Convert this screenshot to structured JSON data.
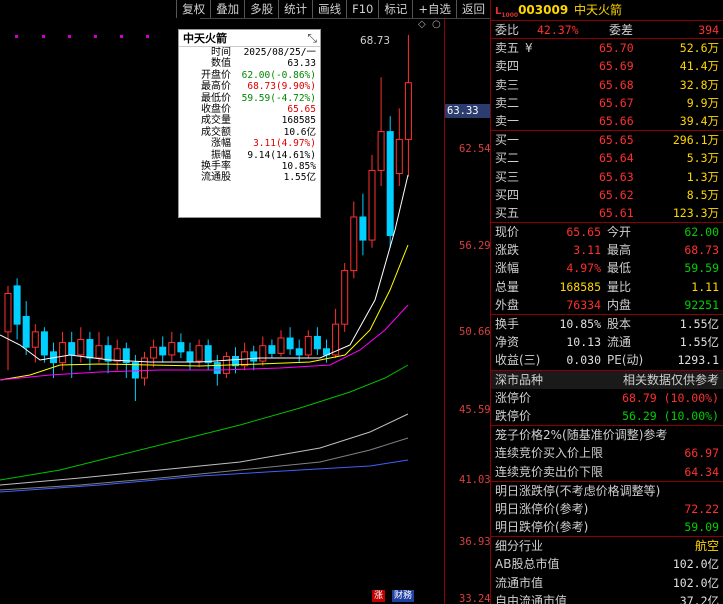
{
  "toolbar": {
    "buttons": [
      "复权",
      "叠加",
      "多股",
      "统计",
      "画线",
      "F10",
      "标记",
      "+自选",
      "返回"
    ]
  },
  "chart": {
    "axis_labels": [
      "62.54",
      "56.29",
      "50.66",
      "45.59",
      "41.03",
      "36.93",
      "33.24"
    ],
    "current_price": "63.33",
    "high_marker": "68.73",
    "bottom_tags": [
      "涨",
      "财務"
    ],
    "colors": {
      "up": "#ff3030",
      "down": "#00d0ff",
      "ma5": "#ffffff",
      "ma10": "#ffff00",
      "ma20": "#ff00ff",
      "ma60": "#00c000",
      "ma120": "#c0c0c0",
      "ma250": "#4060ff"
    }
  },
  "popup": {
    "title": "中天火箭",
    "rows": [
      {
        "label": "时间",
        "value": "2025/08/25/一",
        "color": ""
      },
      {
        "label": "数值",
        "value": "63.33",
        "color": ""
      },
      {
        "label": "开盘价",
        "value": "62.00(-0.86%)",
        "color": "green"
      },
      {
        "label": "最高价",
        "value": "68.73(9.90%)",
        "color": "red"
      },
      {
        "label": "最低价",
        "value": "59.59(-4.72%)",
        "color": "green"
      },
      {
        "label": "收盘价",
        "value": "65.65",
        "color": "red"
      },
      {
        "label": "成交量",
        "value": "168585",
        "color": ""
      },
      {
        "label": "成交额",
        "value": "10.6亿",
        "color": ""
      },
      {
        "label": "涨幅",
        "value": "3.11(4.97%)",
        "color": "red"
      },
      {
        "label": "振幅",
        "value": "9.14(14.61%)",
        "color": ""
      },
      {
        "label": "换手率",
        "value": "10.85%",
        "color": ""
      },
      {
        "label": "流通股",
        "value": "1.55亿",
        "color": ""
      }
    ]
  },
  "panel": {
    "logo": "L",
    "logo_sub": "1000",
    "code": "003009",
    "name": "中天火箭",
    "webi": {
      "label": "委比",
      "value": "42.37%",
      "label2": "委差",
      "value2": "394"
    },
    "asks": [
      {
        "label": "卖五",
        "price": "65.70",
        "vol": "52.6万"
      },
      {
        "label": "卖四",
        "price": "65.69",
        "vol": "41.4万"
      },
      {
        "label": "卖三",
        "price": "65.68",
        "vol": "32.8万"
      },
      {
        "label": "卖二",
        "price": "65.67",
        "vol": "9.9万"
      },
      {
        "label": "卖一",
        "price": "65.66",
        "vol": "39.4万"
      }
    ],
    "bids": [
      {
        "label": "买一",
        "price": "65.65",
        "vol": "296.1万"
      },
      {
        "label": "买二",
        "price": "65.64",
        "vol": "5.3万"
      },
      {
        "label": "买三",
        "price": "65.63",
        "vol": "1.3万"
      },
      {
        "label": "买四",
        "price": "65.62",
        "vol": "8.5万"
      },
      {
        "label": "买五",
        "price": "65.61",
        "vol": "123.3万"
      }
    ],
    "ask5_marker": "¥",
    "quote": [
      {
        "l1": "现价",
        "v1": "65.65",
        "c1": "red",
        "l2": "今开",
        "v2": "62.00",
        "c2": "green"
      },
      {
        "l1": "涨跌",
        "v1": "3.11",
        "c1": "red",
        "l2": "最高",
        "v2": "68.73",
        "c2": "red"
      },
      {
        "l1": "涨幅",
        "v1": "4.97%",
        "c1": "red",
        "l2": "最低",
        "v2": "59.59",
        "c2": "green"
      },
      {
        "l1": "总量",
        "v1": "168585",
        "c1": "yellow",
        "l2": "量比",
        "v2": "1.11",
        "c2": "yellow"
      },
      {
        "l1": "外盘",
        "v1": "76334",
        "c1": "red",
        "l2": "内盘",
        "v2": "92251",
        "c2": "green"
      }
    ],
    "stats": [
      {
        "l1": "换手",
        "v1": "10.85%",
        "l2": "股本",
        "v2": "1.55亿"
      },
      {
        "l1": "净资",
        "v1": "10.13",
        "l2": "流通",
        "v2": "1.55亿"
      },
      {
        "l1": "收益(三)",
        "v1": "0.030",
        "l2": "PE(动)",
        "v2": "1293.1"
      }
    ],
    "market": {
      "left": "深市品种",
      "right": "相关数据仅供参考"
    },
    "limits": [
      {
        "label": "涨停价",
        "value": "68.79 (10.00%)",
        "color": "red"
      },
      {
        "label": "跌停价",
        "value": "56.29 (10.00%)",
        "color": "green"
      }
    ],
    "cage_title": "笼子价格2%(随基准价调整)参考",
    "cage": [
      {
        "label": "连续竞价买入价上限",
        "value": "66.97",
        "color": "red"
      },
      {
        "label": "连续竞价卖出价下限",
        "value": "64.34",
        "color": "red"
      }
    ],
    "tomorrow_title": "明日涨跌停(不考虑价格调整等)",
    "tomorrow": [
      {
        "label": "明日涨停价(参考)",
        "value": "72.22",
        "color": "red"
      },
      {
        "label": "明日跌停价(参考)",
        "value": "59.09",
        "color": "green"
      }
    ],
    "industry": {
      "label": "细分行业",
      "value": "航空"
    },
    "caps": [
      {
        "label": "AB股总市值",
        "value": "102.0亿"
      },
      {
        "label": "流通市值",
        "value": "102.0亿"
      },
      {
        "label": "自由流通市值",
        "value": "37.2亿"
      }
    ]
  }
}
